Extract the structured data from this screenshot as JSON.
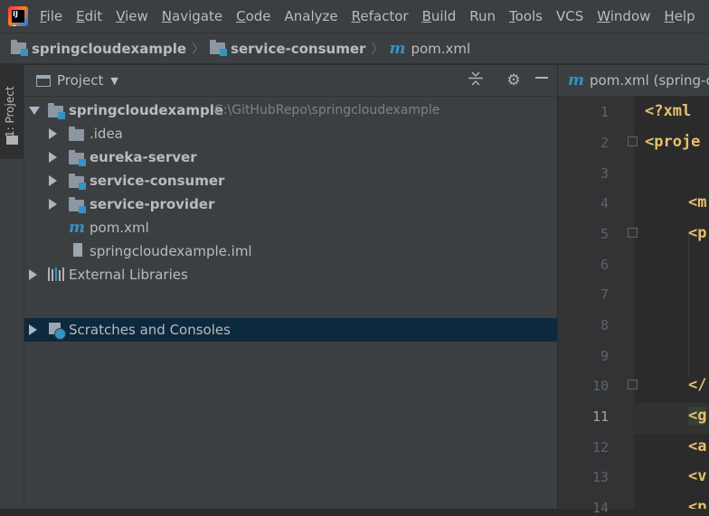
{
  "menubar": {
    "items": [
      {
        "mnemonic": "F",
        "rest": "ile"
      },
      {
        "mnemonic": "E",
        "rest": "dit"
      },
      {
        "mnemonic": "V",
        "rest": "iew"
      },
      {
        "mnemonic": "N",
        "rest": "avigate"
      },
      {
        "mnemonic": "C",
        "rest": "ode"
      },
      {
        "mnemonic": "",
        "rest": "Analyze"
      },
      {
        "mnemonic": "R",
        "rest": "efactor"
      },
      {
        "mnemonic": "B",
        "rest": "uild"
      },
      {
        "mnemonic": "",
        "rest": "Run"
      },
      {
        "mnemonic": "T",
        "rest": "ools"
      },
      {
        "mnemonic": "",
        "rest": "VCS"
      },
      {
        "mnemonic": "W",
        "rest": "indow"
      },
      {
        "mnemonic": "H",
        "rest": "elp"
      }
    ]
  },
  "breadcrumb": {
    "items": [
      "springcloudexample",
      "service-consumer",
      "pom.xml"
    ]
  },
  "side_tab": {
    "label": "1: Project"
  },
  "project_panel": {
    "title": "Project",
    "tree": [
      {
        "label": "springcloudexample",
        "path": "C:\\GitHubRepo\\springcloudexample"
      },
      {
        "label": ".idea"
      },
      {
        "label": "eureka-server"
      },
      {
        "label": "service-consumer"
      },
      {
        "label": "service-provider"
      },
      {
        "label": "pom.xml"
      },
      {
        "label": "springcloudexample.iml"
      },
      {
        "label": "External Libraries"
      },
      {
        "label": "Scratches and Consoles"
      }
    ]
  },
  "editor": {
    "tab_label": "pom.xml (spring-c",
    "line_numbers": [
      "1",
      "2",
      "3",
      "4",
      "5",
      "6",
      "7",
      "8",
      "9",
      "10",
      "11",
      "12",
      "13",
      "14"
    ],
    "current_line": "11",
    "code": {
      "l1": "<?xml",
      "l2": "<proje",
      "l4": "<m",
      "l5": "<p",
      "l10": "</",
      "l11": "<g",
      "l12": "<a",
      "l13": "<v",
      "l14": "<p"
    }
  },
  "colors": {
    "selection": "#0d293e",
    "accent": "#3592c4",
    "tag": "#e8bf6a"
  },
  "icons": [
    "intellij-logo-icon",
    "folder-icon",
    "module-folder-icon",
    "maven-icon",
    "gear-icon",
    "collapse-all-icon",
    "hide-icon",
    "library-icon",
    "scratch-icon",
    "bulb-icon"
  ]
}
